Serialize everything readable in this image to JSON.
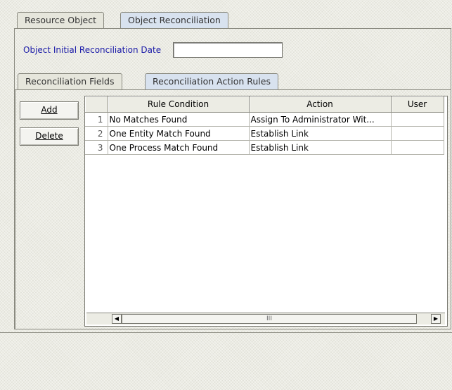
{
  "top_tabs": [
    "Resource Object",
    "Object Reconciliation"
  ],
  "date_field": {
    "label": "Object Initial Reconciliation Date",
    "value": ""
  },
  "inner_tabs": [
    "Reconciliation Fields",
    "Reconciliation Action Rules"
  ],
  "buttons": {
    "add_label": "Add",
    "delete_label": "Delete"
  },
  "table": {
    "columns": [
      "Rule Condition",
      "Action",
      "User"
    ],
    "rows": [
      {
        "num": "1",
        "condition": "No Matches Found",
        "action": "Assign To Administrator Wit...",
        "user": ""
      },
      {
        "num": "2",
        "condition": "One Entity Match Found",
        "action": "Establish Link",
        "user": ""
      },
      {
        "num": "3",
        "condition": "One Process Match Found",
        "action": "Establish Link",
        "user": ""
      }
    ]
  },
  "scrollbar": {
    "thumb_glyph": "III",
    "left_arrow": "◀",
    "right_arrow": "▶"
  }
}
